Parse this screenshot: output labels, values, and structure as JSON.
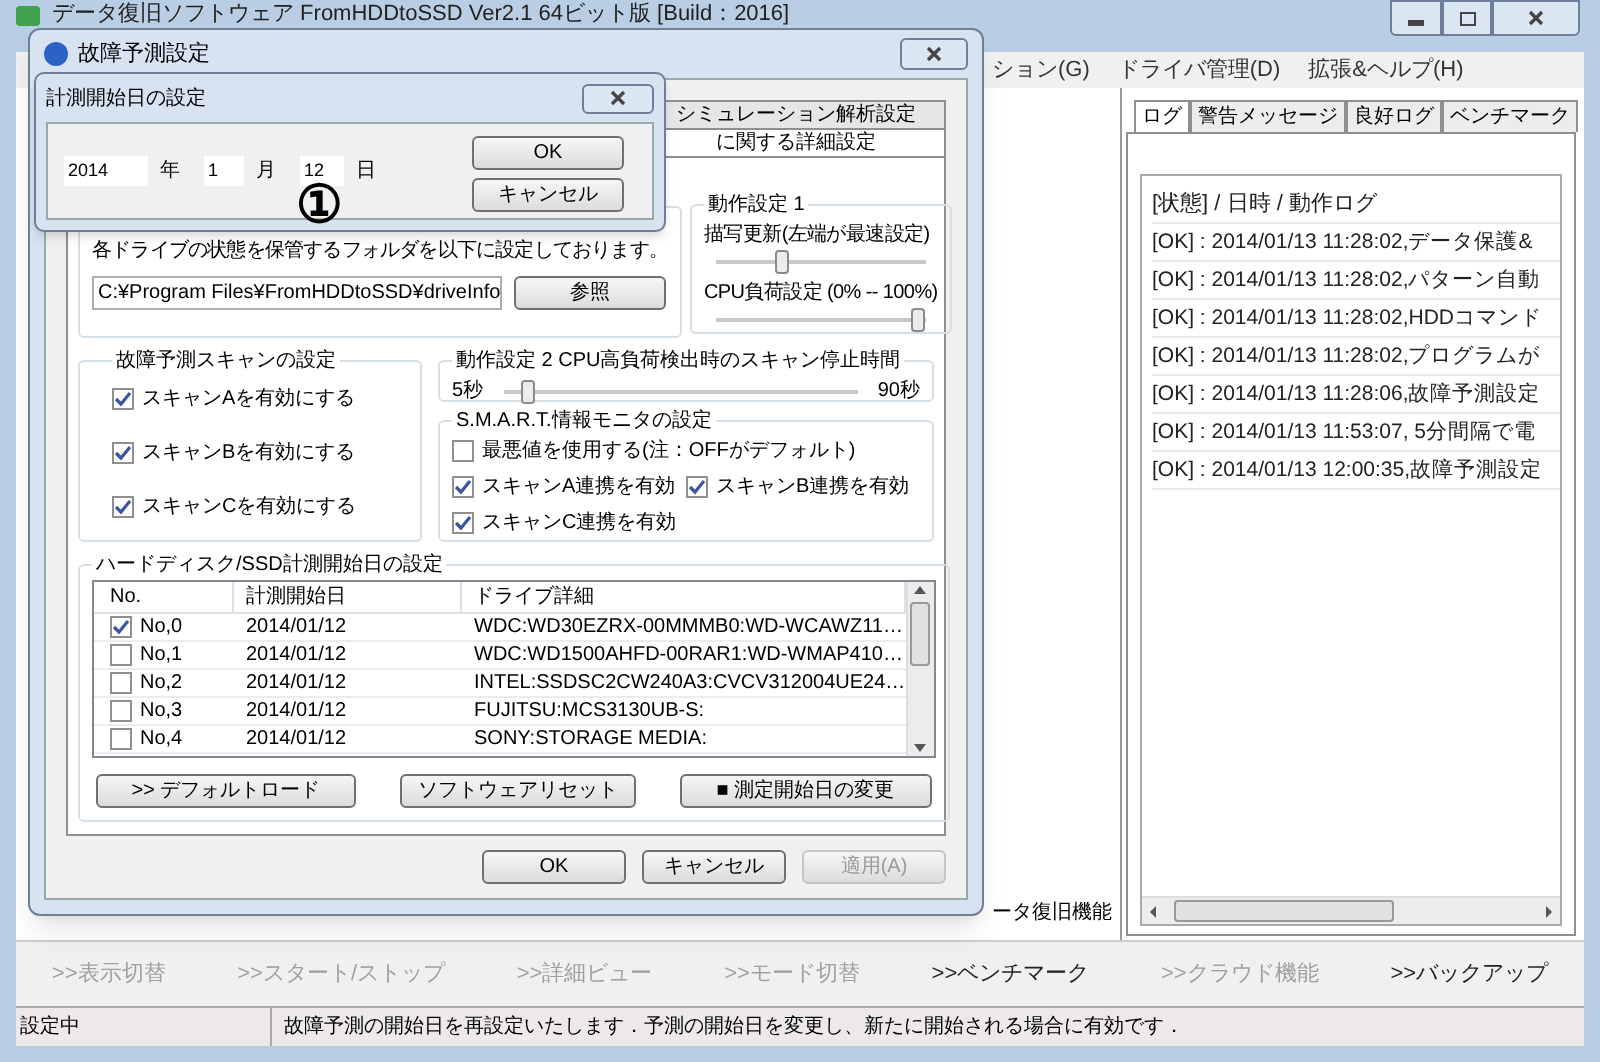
{
  "main_window": {
    "title": "データ復旧ソフトウェア FromHDDtoSSD Ver2.1 64ビット版 [Build：2016]",
    "menu": [
      "ション(G)",
      "ドライバ管理(D)",
      "拡張&ヘルプ(H)"
    ],
    "log_tabs": [
      {
        "label": "ログ",
        "selected": true
      },
      {
        "label": "警告メッセージ",
        "selected": false
      },
      {
        "label": "良好ログ",
        "selected": false
      },
      {
        "label": "ベンチマーク",
        "selected": false
      }
    ],
    "log": {
      "header": "[状態] / 日時 / 動作ログ",
      "rows": [
        "[OK] : 2014/01/13 11:28:02,データ保護&",
        "[OK] : 2014/01/13 11:28:02,パターン自動",
        "[OK] : 2014/01/13 11:28:02,HDDコマンド",
        "[OK] : 2014/01/13 11:28:02,プログラムが",
        "[OK] : 2014/01/13 11:28:06,故障予測設定",
        "[OK] : 2014/01/13 11:53:07, 5分間隔で電",
        "[OK] : 2014/01/13 12:00:35,故障予測設定"
      ]
    },
    "background_label": "ータ復旧機能",
    "toolbar": [
      {
        "label": ">>表示切替",
        "disabled": true
      },
      {
        "label": ">>スタート/ストップ",
        "disabled": true
      },
      {
        "label": ">>詳細ビュー",
        "disabled": true
      },
      {
        "label": ">>モード切替",
        "disabled": true
      },
      {
        "label": ">>ベンチマーク",
        "disabled": false
      },
      {
        "label": ">>クラウド機能",
        "disabled": true
      },
      {
        "label": ">>バックアップ",
        "disabled": false
      }
    ],
    "status_bar": {
      "state": "設定中",
      "message": "故障予測の開始日を再設定いたします．予測の開始日を変更し、新たに開始される場合に有効です．"
    }
  },
  "settings_dialog": {
    "title": "故障予測設定",
    "tabs": [
      {
        "label": "シミュレーション解析設定",
        "selected": false
      },
      {
        "label": "に関する詳細設定",
        "selected": true
      }
    ],
    "folder_text": "各ドライブの状態を保管するフォルダを以下に設定しております。",
    "folder_path": "C:¥Program Files¥FromHDDtoSSD¥driveInfo",
    "browse_button": "参照",
    "op1": {
      "title": "動作設定 1",
      "sliders": [
        {
          "label": "描写更新(左端が最速設定)",
          "level": 0.3
        },
        {
          "label": "CPU負荷設定 (0% -- 100%)",
          "level": 1
        }
      ]
    },
    "scan": {
      "title": "故障予測スキャンの設定",
      "options": [
        {
          "label": "スキャンAを有効にする",
          "checked": true
        },
        {
          "label": "スキャンBを有効にする",
          "checked": true
        },
        {
          "label": "スキャンCを有効にする",
          "checked": true
        }
      ]
    },
    "op2": {
      "title": "動作設定 2 CPU高負荷検出時のスキャン停止時間",
      "min": "5秒",
      "max": "90秒",
      "level": 0.05
    },
    "smart": {
      "title": "S.M.A.R.T.情報モニタの設定",
      "options": [
        {
          "label": "最悪値を使用する(注：OFFがデフォルト)",
          "checked": false
        },
        {
          "label": "スキャンA連携を有効",
          "checked": true
        },
        {
          "label": "スキャンB連携を有効",
          "checked": true
        },
        {
          "label": "スキャンC連携を有効",
          "checked": true
        }
      ]
    },
    "drives": {
      "title": "ハードディスク/SSD計測開始日の設定",
      "columns": [
        "No.",
        "計測開始日",
        "ドライブ詳細"
      ],
      "rows": [
        {
          "checked": true,
          "no": "No,0",
          "date": "2014/01/12",
          "detail": "WDC:WD30EZRX-00MMMB0:WD-WCAWZ11…"
        },
        {
          "checked": false,
          "no": "No,1",
          "date": "2014/01/12",
          "detail": "WDC:WD1500AHFD-00RAR1:WD-WMAP410…"
        },
        {
          "checked": false,
          "no": "No,2",
          "date": "2014/01/12",
          "detail": "INTEL:SSDSC2CW240A3:CVCV312004UE24…"
        },
        {
          "checked": false,
          "no": "No,3",
          "date": "2014/01/12",
          "detail": "FUJITSU:MCS3130UB-S:"
        },
        {
          "checked": false,
          "no": "No,4",
          "date": "2014/01/12",
          "detail": "SONY:STORAGE MEDIA:"
        }
      ],
      "buttons": [
        ">> デフォルトロード",
        "ソフトウェアリセット",
        "■ 測定開始日の変更"
      ]
    },
    "buttons": [
      {
        "label": "OK",
        "disabled": false
      },
      {
        "label": "キャンセル",
        "disabled": false
      },
      {
        "label": "適用(A)",
        "disabled": true
      }
    ]
  },
  "date_dialog": {
    "title": "計測開始日の設定",
    "year": "2014",
    "year_label": "年",
    "month": "1",
    "month_label": "月",
    "day": "12",
    "day_label": "日",
    "buttons": [
      "OK",
      "キャンセル"
    ]
  },
  "annotation": "①"
}
